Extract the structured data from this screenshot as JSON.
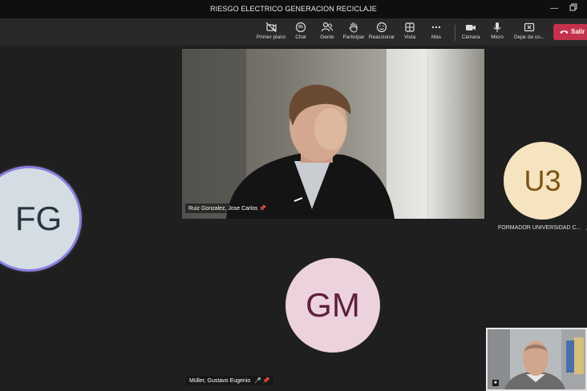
{
  "window": {
    "title": "RIESGO ELECTRICO GENERACION RECICLAJE"
  },
  "toolbar": {
    "primer_plano": "Primer plano",
    "chat": "Chat",
    "gente": "Gente",
    "participar": "Participar",
    "reaccionar": "Reaccionar",
    "vista": "Vista",
    "mas": "Más",
    "camara": "Cámara",
    "micro": "Micro",
    "dejar": "Dejar de co...",
    "salir": "Salir"
  },
  "participants": {
    "main_video": {
      "name": "Ruiz Gonzalez, Jose Carlos"
    },
    "fg": {
      "initials": "FG"
    },
    "u3": {
      "initials": "U3",
      "name": "FORMADOR UNIVERSIDAD C..."
    },
    "gm": {
      "initials": "GM",
      "name": "Müller, Gustavo Eugenio"
    }
  },
  "colors": {
    "leave": "#c4314b",
    "fg_bg": "#d3dde3",
    "u3_bg": "#f6e3c0",
    "gm_bg": "#ecd2dd",
    "speaking_ring": "#8b7fe0"
  }
}
